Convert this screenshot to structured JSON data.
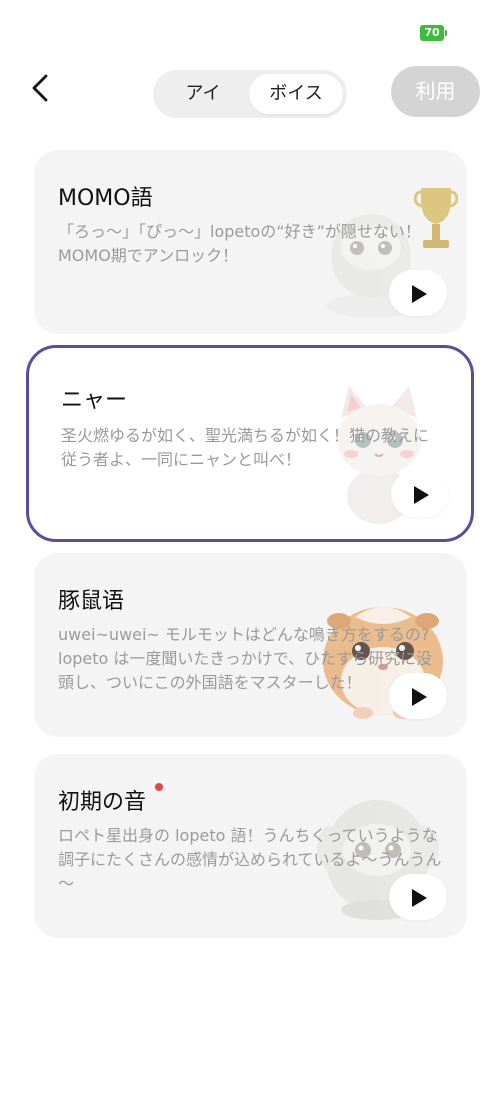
{
  "status": {
    "battery": "70"
  },
  "header": {
    "tabs": [
      {
        "label": "アイ",
        "selected": false
      },
      {
        "label": "ボイス",
        "selected": true
      }
    ],
    "use_button": "利用"
  },
  "colors": {
    "accent": "#5a4da0",
    "battery": "#3dbb3d",
    "new_dot": "#e04848",
    "disabled_button": "#d4d4d4"
  },
  "voices": [
    {
      "title": "MOMO語",
      "description": "「ろっ～」「ぴっ～」lopetoの“好き”が隠せない！MOMO期でアンロック！",
      "mascot": "white-robot-trophy-icon",
      "selected": false,
      "new": false
    },
    {
      "title": "ニャー",
      "description": "圣火燃ゆるが如く、聖光満ちるが如く！猫の教えに従う者よ、一同にニャンと叫べ！",
      "mascot": "cat-icon",
      "selected": true,
      "new": false
    },
    {
      "title": "豚鼠语",
      "description": "uwei~uwei~ モルモットはどんな鳴き方をするの? lopeto は一度聞いたきっかけで、ひたすら研究に没頭し、ついにこの外国語をマスターした！",
      "mascot": "guinea-pig-icon",
      "selected": false,
      "new": false
    },
    {
      "title": "初期の音",
      "description": "ロペト星出身の lopeto 語！うんちくっていうような調子にたくさんの感情が込められているよ～うんうん～",
      "mascot": "fluffy-sheep-icon",
      "selected": false,
      "new": true
    }
  ]
}
